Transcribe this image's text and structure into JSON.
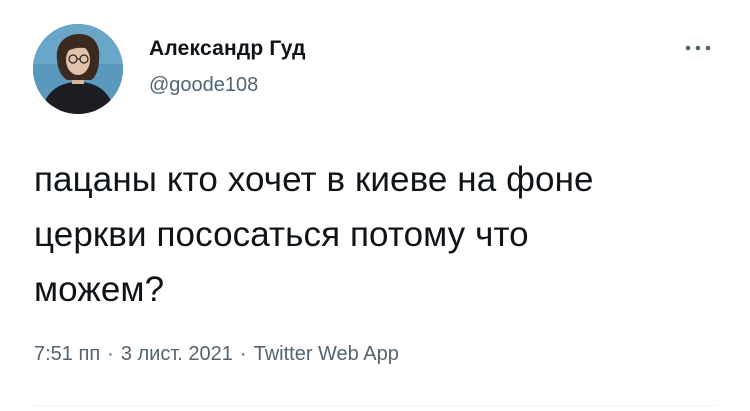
{
  "author": {
    "display_name": "Александр Гуд",
    "handle": "@goode108",
    "avatar_icon": "user-avatar"
  },
  "menu": {
    "icon": "more-horizontal-icon"
  },
  "tweet": {
    "text_lines": [
      "пацаны кто хочет в киеве на фоне",
      "церкви пососаться потому что",
      "можем?"
    ]
  },
  "meta": {
    "time": "7:51 пп",
    "separator": "·",
    "date": "3 лист. 2021",
    "source": "Twitter Web App"
  },
  "colors": {
    "text_primary": "#0f1419",
    "text_secondary": "#536471",
    "divider": "#eff3f4"
  }
}
